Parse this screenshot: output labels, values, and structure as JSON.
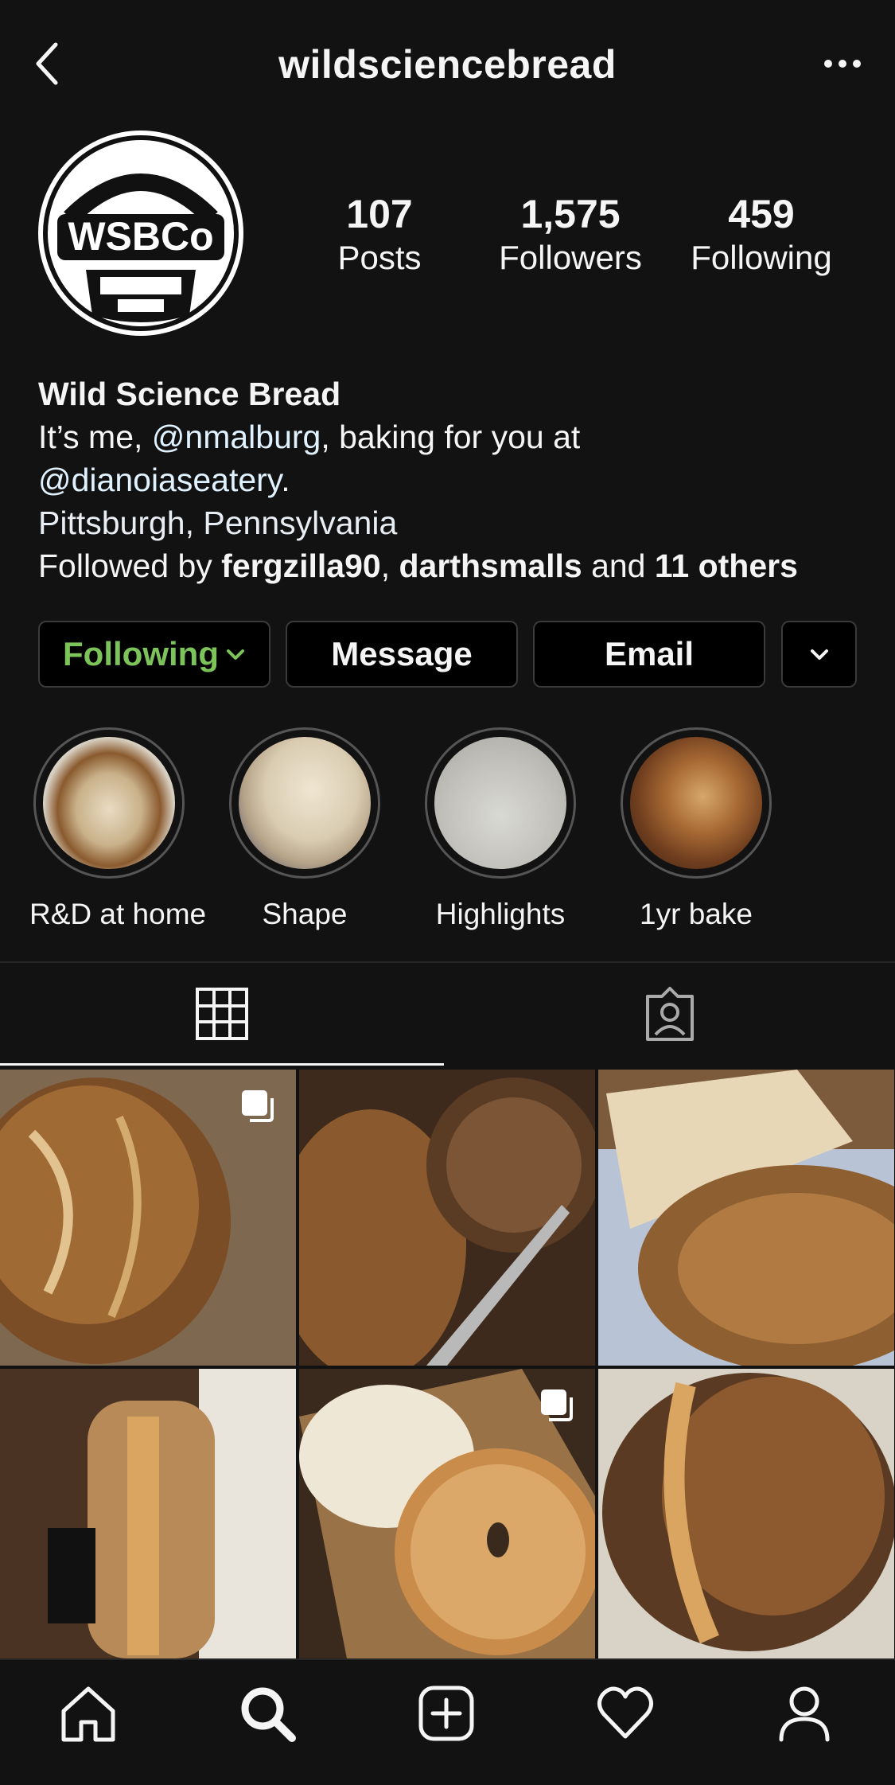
{
  "header": {
    "username": "wildsciencebread"
  },
  "avatar": {
    "logo_text": "WSBCo"
  },
  "stats": [
    {
      "value": "107",
      "label": "Posts"
    },
    {
      "value": "1,575",
      "label": "Followers"
    },
    {
      "value": "459",
      "label": "Following"
    }
  ],
  "bio": {
    "name": "Wild Science Bread",
    "line1_prefix": "It’s me, ",
    "line1_mention": "@nmalburg",
    "line1_suffix": ", baking for you at",
    "line2_mention": "@dianoiaseatery",
    "line2_suffix": ".",
    "location": "Pittsburgh, Pennsylvania",
    "followed_prefix": "Followed by ",
    "followed_user1": "fergzilla90",
    "followed_sep": ", ",
    "followed_user2": "darthsmalls",
    "followed_and": " and ",
    "followed_others": "11 others"
  },
  "actions": {
    "following": "Following",
    "message": "Message",
    "email": "Email"
  },
  "highlights": [
    {
      "label": "R&D at home"
    },
    {
      "label": "Shape"
    },
    {
      "label": "Highlights"
    },
    {
      "label": "1yr bake"
    }
  ],
  "tabs": {
    "active": "grid",
    "items": [
      "grid-icon",
      "tagged-icon"
    ]
  },
  "posts": [
    {
      "kind": "bread-loaf-wood",
      "multi": true
    },
    {
      "kind": "bread-cut-knife",
      "multi": false
    },
    {
      "kind": "bread-crumb-slices",
      "multi": false
    },
    {
      "kind": "bread-batard",
      "multi": false
    },
    {
      "kind": "bagel-slice",
      "multi": true
    },
    {
      "kind": "bread-boule",
      "multi": false
    }
  ],
  "nav": [
    "home-icon",
    "search-icon",
    "new-post-icon",
    "activity-icon",
    "profile-icon"
  ],
  "colors": {
    "background": "#121212",
    "following_green": "#7cc35a",
    "text": "#f5f5f5"
  }
}
